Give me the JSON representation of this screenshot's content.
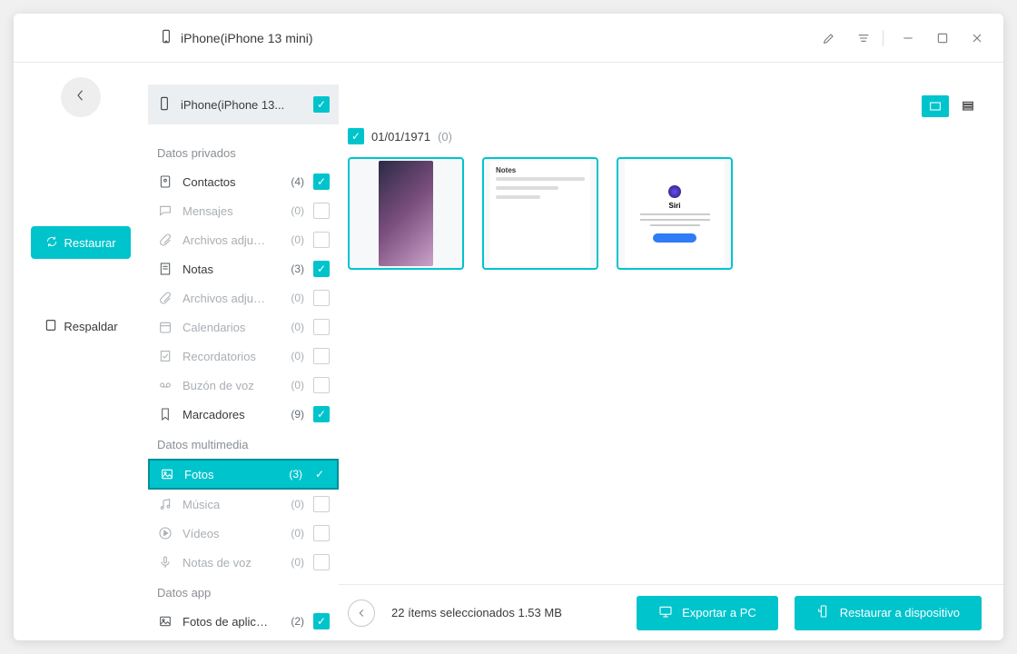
{
  "titlebar": {
    "device_name": "iPhone(iPhone 13 mini)"
  },
  "leftrail": {
    "restore_label": "Restaurar",
    "backup_label": "Respaldar"
  },
  "device_chip": {
    "label": "iPhone(iPhone 13...",
    "checked": true
  },
  "sections": {
    "private_title": "Datos privados",
    "media_title": "Datos multimedia",
    "app_title": "Datos app"
  },
  "categories": {
    "private": [
      {
        "key": "contacts",
        "name": "Contactos",
        "count": "(4)",
        "checked": true,
        "enabled": true
      },
      {
        "key": "messages",
        "name": "Mensajes",
        "count": "(0)",
        "checked": false,
        "enabled": false
      },
      {
        "key": "attach1",
        "name": "Archivos adjunt...",
        "count": "(0)",
        "checked": false,
        "enabled": false
      },
      {
        "key": "notes",
        "name": "Notas",
        "count": "(3)",
        "checked": true,
        "enabled": true
      },
      {
        "key": "attach2",
        "name": "Archivos adjunt...",
        "count": "(0)",
        "checked": false,
        "enabled": false
      },
      {
        "key": "calendars",
        "name": "Calendarios",
        "count": "(0)",
        "checked": false,
        "enabled": false
      },
      {
        "key": "reminders",
        "name": "Recordatorios",
        "count": "(0)",
        "checked": false,
        "enabled": false
      },
      {
        "key": "voicemail",
        "name": "Buzón de voz",
        "count": "(0)",
        "checked": false,
        "enabled": false
      },
      {
        "key": "bookmarks",
        "name": "Marcadores",
        "count": "(9)",
        "checked": true,
        "enabled": true
      }
    ],
    "media": [
      {
        "key": "photos",
        "name": "Fotos",
        "count": "(3)",
        "checked": true,
        "enabled": true,
        "selected": true
      },
      {
        "key": "music",
        "name": "Música",
        "count": "(0)",
        "checked": false,
        "enabled": false
      },
      {
        "key": "videos",
        "name": "Vídeos",
        "count": "(0)",
        "checked": false,
        "enabled": false
      },
      {
        "key": "voicenotes",
        "name": "Notas de voz",
        "count": "(0)",
        "checked": false,
        "enabled": false
      }
    ],
    "app": [
      {
        "key": "appphotos",
        "name": "Fotos de aplicaci...",
        "count": "(2)",
        "checked": true,
        "enabled": true
      }
    ]
  },
  "content": {
    "date_label": "01/01/1971",
    "date_count": "(0)",
    "date_checked": true
  },
  "footer": {
    "status": "22 ítems seleccionados 1.53 MB",
    "export_label": "Exportar a PC",
    "restore_label": "Restaurar a dispositivo"
  }
}
